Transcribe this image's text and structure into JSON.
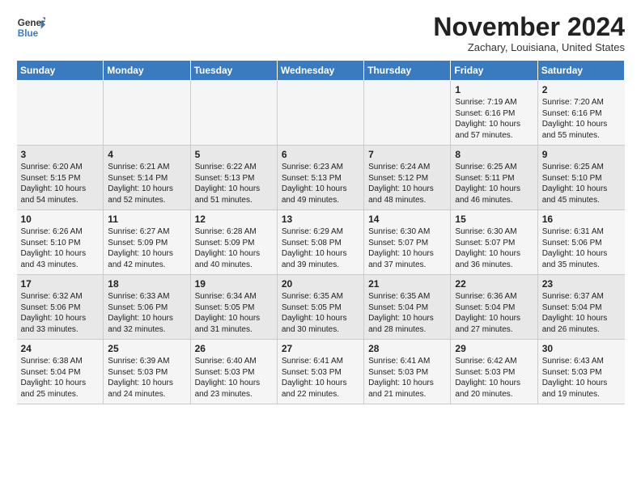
{
  "logo": {
    "line1": "General",
    "line2": "Blue"
  },
  "title": "November 2024",
  "subtitle": "Zachary, Louisiana, United States",
  "days_of_week": [
    "Sunday",
    "Monday",
    "Tuesday",
    "Wednesday",
    "Thursday",
    "Friday",
    "Saturday"
  ],
  "weeks": [
    [
      {
        "day": "",
        "info": ""
      },
      {
        "day": "",
        "info": ""
      },
      {
        "day": "",
        "info": ""
      },
      {
        "day": "",
        "info": ""
      },
      {
        "day": "",
        "info": ""
      },
      {
        "day": "1",
        "info": "Sunrise: 7:19 AM\nSunset: 6:16 PM\nDaylight: 10 hours\nand 57 minutes."
      },
      {
        "day": "2",
        "info": "Sunrise: 7:20 AM\nSunset: 6:16 PM\nDaylight: 10 hours\nand 55 minutes."
      }
    ],
    [
      {
        "day": "3",
        "info": "Sunrise: 6:20 AM\nSunset: 5:15 PM\nDaylight: 10 hours\nand 54 minutes."
      },
      {
        "day": "4",
        "info": "Sunrise: 6:21 AM\nSunset: 5:14 PM\nDaylight: 10 hours\nand 52 minutes."
      },
      {
        "day": "5",
        "info": "Sunrise: 6:22 AM\nSunset: 5:13 PM\nDaylight: 10 hours\nand 51 minutes."
      },
      {
        "day": "6",
        "info": "Sunrise: 6:23 AM\nSunset: 5:13 PM\nDaylight: 10 hours\nand 49 minutes."
      },
      {
        "day": "7",
        "info": "Sunrise: 6:24 AM\nSunset: 5:12 PM\nDaylight: 10 hours\nand 48 minutes."
      },
      {
        "day": "8",
        "info": "Sunrise: 6:25 AM\nSunset: 5:11 PM\nDaylight: 10 hours\nand 46 minutes."
      },
      {
        "day": "9",
        "info": "Sunrise: 6:25 AM\nSunset: 5:10 PM\nDaylight: 10 hours\nand 45 minutes."
      }
    ],
    [
      {
        "day": "10",
        "info": "Sunrise: 6:26 AM\nSunset: 5:10 PM\nDaylight: 10 hours\nand 43 minutes."
      },
      {
        "day": "11",
        "info": "Sunrise: 6:27 AM\nSunset: 5:09 PM\nDaylight: 10 hours\nand 42 minutes."
      },
      {
        "day": "12",
        "info": "Sunrise: 6:28 AM\nSunset: 5:09 PM\nDaylight: 10 hours\nand 40 minutes."
      },
      {
        "day": "13",
        "info": "Sunrise: 6:29 AM\nSunset: 5:08 PM\nDaylight: 10 hours\nand 39 minutes."
      },
      {
        "day": "14",
        "info": "Sunrise: 6:30 AM\nSunset: 5:07 PM\nDaylight: 10 hours\nand 37 minutes."
      },
      {
        "day": "15",
        "info": "Sunrise: 6:30 AM\nSunset: 5:07 PM\nDaylight: 10 hours\nand 36 minutes."
      },
      {
        "day": "16",
        "info": "Sunrise: 6:31 AM\nSunset: 5:06 PM\nDaylight: 10 hours\nand 35 minutes."
      }
    ],
    [
      {
        "day": "17",
        "info": "Sunrise: 6:32 AM\nSunset: 5:06 PM\nDaylight: 10 hours\nand 33 minutes."
      },
      {
        "day": "18",
        "info": "Sunrise: 6:33 AM\nSunset: 5:06 PM\nDaylight: 10 hours\nand 32 minutes."
      },
      {
        "day": "19",
        "info": "Sunrise: 6:34 AM\nSunset: 5:05 PM\nDaylight: 10 hours\nand 31 minutes."
      },
      {
        "day": "20",
        "info": "Sunrise: 6:35 AM\nSunset: 5:05 PM\nDaylight: 10 hours\nand 30 minutes."
      },
      {
        "day": "21",
        "info": "Sunrise: 6:35 AM\nSunset: 5:04 PM\nDaylight: 10 hours\nand 28 minutes."
      },
      {
        "day": "22",
        "info": "Sunrise: 6:36 AM\nSunset: 5:04 PM\nDaylight: 10 hours\nand 27 minutes."
      },
      {
        "day": "23",
        "info": "Sunrise: 6:37 AM\nSunset: 5:04 PM\nDaylight: 10 hours\nand 26 minutes."
      }
    ],
    [
      {
        "day": "24",
        "info": "Sunrise: 6:38 AM\nSunset: 5:04 PM\nDaylight: 10 hours\nand 25 minutes."
      },
      {
        "day": "25",
        "info": "Sunrise: 6:39 AM\nSunset: 5:03 PM\nDaylight: 10 hours\nand 24 minutes."
      },
      {
        "day": "26",
        "info": "Sunrise: 6:40 AM\nSunset: 5:03 PM\nDaylight: 10 hours\nand 23 minutes."
      },
      {
        "day": "27",
        "info": "Sunrise: 6:41 AM\nSunset: 5:03 PM\nDaylight: 10 hours\nand 22 minutes."
      },
      {
        "day": "28",
        "info": "Sunrise: 6:41 AM\nSunset: 5:03 PM\nDaylight: 10 hours\nand 21 minutes."
      },
      {
        "day": "29",
        "info": "Sunrise: 6:42 AM\nSunset: 5:03 PM\nDaylight: 10 hours\nand 20 minutes."
      },
      {
        "day": "30",
        "info": "Sunrise: 6:43 AM\nSunset: 5:03 PM\nDaylight: 10 hours\nand 19 minutes."
      }
    ]
  ]
}
